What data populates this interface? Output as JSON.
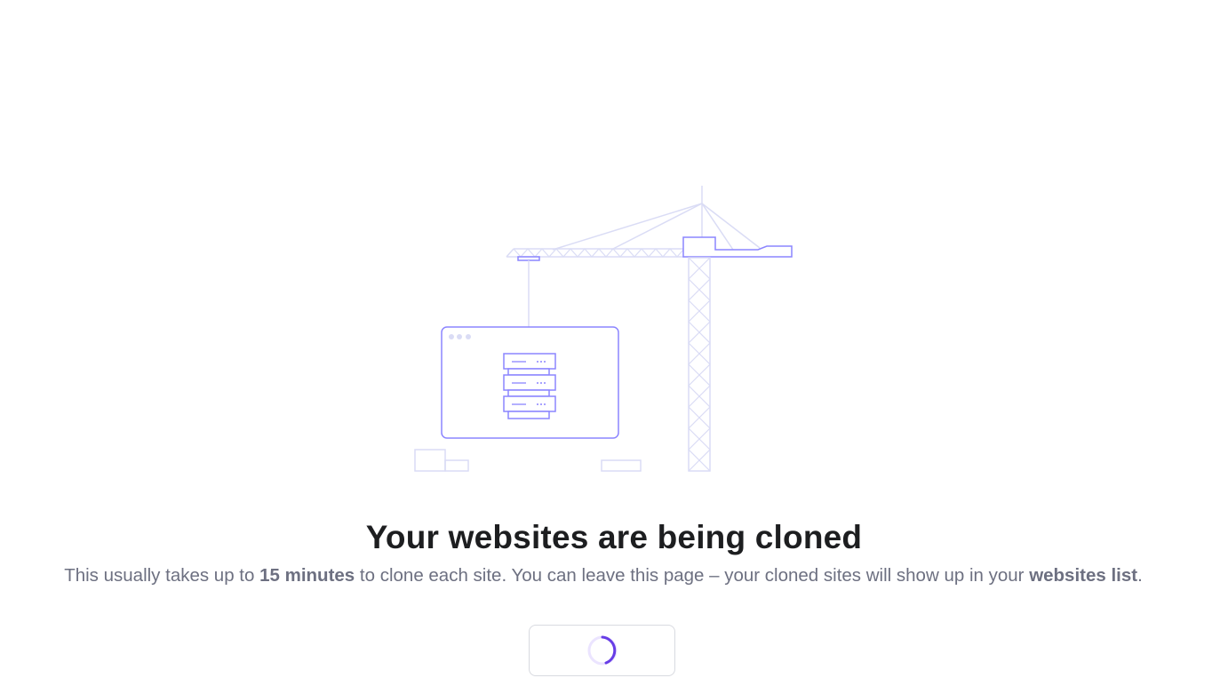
{
  "main": {
    "title": "Your websites are being cloned",
    "description": {
      "part1": "This usually takes up to ",
      "bold1": "15 minutes",
      "part2": " to clone each site. You can leave this page – your cloned sites will show up in your ",
      "bold2": "websites list",
      "part3": "."
    },
    "loading_button": {
      "state": "loading",
      "icon": "spinner-icon"
    }
  },
  "colors": {
    "accent": "#673de6",
    "illustration_stroke": "#8c85ff",
    "illustration_light": "#dadcf5",
    "title_text": "#1d1e20",
    "body_text": "#6d7081",
    "button_border": "#d8dae0"
  },
  "illustration": {
    "icon": "construction-crane-server-illustration"
  }
}
